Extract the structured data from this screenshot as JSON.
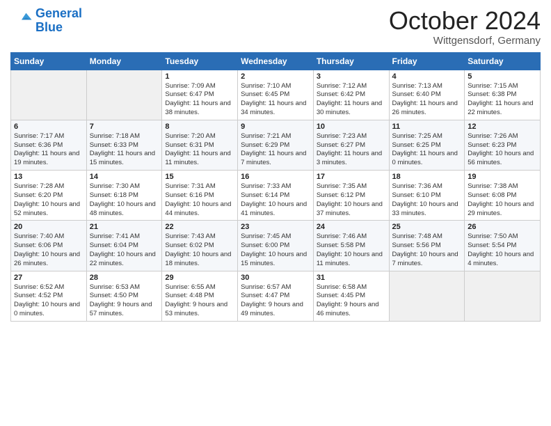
{
  "header": {
    "logo_line1": "General",
    "logo_line2": "Blue",
    "month": "October 2024",
    "location": "Wittgensdorf, Germany"
  },
  "days_of_week": [
    "Sunday",
    "Monday",
    "Tuesday",
    "Wednesday",
    "Thursday",
    "Friday",
    "Saturday"
  ],
  "weeks": [
    [
      {
        "day": "",
        "info": ""
      },
      {
        "day": "",
        "info": ""
      },
      {
        "day": "1",
        "info": "Sunrise: 7:09 AM\nSunset: 6:47 PM\nDaylight: 11 hours and 38 minutes."
      },
      {
        "day": "2",
        "info": "Sunrise: 7:10 AM\nSunset: 6:45 PM\nDaylight: 11 hours and 34 minutes."
      },
      {
        "day": "3",
        "info": "Sunrise: 7:12 AM\nSunset: 6:42 PM\nDaylight: 11 hours and 30 minutes."
      },
      {
        "day": "4",
        "info": "Sunrise: 7:13 AM\nSunset: 6:40 PM\nDaylight: 11 hours and 26 minutes."
      },
      {
        "day": "5",
        "info": "Sunrise: 7:15 AM\nSunset: 6:38 PM\nDaylight: 11 hours and 22 minutes."
      }
    ],
    [
      {
        "day": "6",
        "info": "Sunrise: 7:17 AM\nSunset: 6:36 PM\nDaylight: 11 hours and 19 minutes."
      },
      {
        "day": "7",
        "info": "Sunrise: 7:18 AM\nSunset: 6:33 PM\nDaylight: 11 hours and 15 minutes."
      },
      {
        "day": "8",
        "info": "Sunrise: 7:20 AM\nSunset: 6:31 PM\nDaylight: 11 hours and 11 minutes."
      },
      {
        "day": "9",
        "info": "Sunrise: 7:21 AM\nSunset: 6:29 PM\nDaylight: 11 hours and 7 minutes."
      },
      {
        "day": "10",
        "info": "Sunrise: 7:23 AM\nSunset: 6:27 PM\nDaylight: 11 hours and 3 minutes."
      },
      {
        "day": "11",
        "info": "Sunrise: 7:25 AM\nSunset: 6:25 PM\nDaylight: 11 hours and 0 minutes."
      },
      {
        "day": "12",
        "info": "Sunrise: 7:26 AM\nSunset: 6:23 PM\nDaylight: 10 hours and 56 minutes."
      }
    ],
    [
      {
        "day": "13",
        "info": "Sunrise: 7:28 AM\nSunset: 6:20 PM\nDaylight: 10 hours and 52 minutes."
      },
      {
        "day": "14",
        "info": "Sunrise: 7:30 AM\nSunset: 6:18 PM\nDaylight: 10 hours and 48 minutes."
      },
      {
        "day": "15",
        "info": "Sunrise: 7:31 AM\nSunset: 6:16 PM\nDaylight: 10 hours and 44 minutes."
      },
      {
        "day": "16",
        "info": "Sunrise: 7:33 AM\nSunset: 6:14 PM\nDaylight: 10 hours and 41 minutes."
      },
      {
        "day": "17",
        "info": "Sunrise: 7:35 AM\nSunset: 6:12 PM\nDaylight: 10 hours and 37 minutes."
      },
      {
        "day": "18",
        "info": "Sunrise: 7:36 AM\nSunset: 6:10 PM\nDaylight: 10 hours and 33 minutes."
      },
      {
        "day": "19",
        "info": "Sunrise: 7:38 AM\nSunset: 6:08 PM\nDaylight: 10 hours and 29 minutes."
      }
    ],
    [
      {
        "day": "20",
        "info": "Sunrise: 7:40 AM\nSunset: 6:06 PM\nDaylight: 10 hours and 26 minutes."
      },
      {
        "day": "21",
        "info": "Sunrise: 7:41 AM\nSunset: 6:04 PM\nDaylight: 10 hours and 22 minutes."
      },
      {
        "day": "22",
        "info": "Sunrise: 7:43 AM\nSunset: 6:02 PM\nDaylight: 10 hours and 18 minutes."
      },
      {
        "day": "23",
        "info": "Sunrise: 7:45 AM\nSunset: 6:00 PM\nDaylight: 10 hours and 15 minutes."
      },
      {
        "day": "24",
        "info": "Sunrise: 7:46 AM\nSunset: 5:58 PM\nDaylight: 10 hours and 11 minutes."
      },
      {
        "day": "25",
        "info": "Sunrise: 7:48 AM\nSunset: 5:56 PM\nDaylight: 10 hours and 7 minutes."
      },
      {
        "day": "26",
        "info": "Sunrise: 7:50 AM\nSunset: 5:54 PM\nDaylight: 10 hours and 4 minutes."
      }
    ],
    [
      {
        "day": "27",
        "info": "Sunrise: 6:52 AM\nSunset: 4:52 PM\nDaylight: 10 hours and 0 minutes."
      },
      {
        "day": "28",
        "info": "Sunrise: 6:53 AM\nSunset: 4:50 PM\nDaylight: 9 hours and 57 minutes."
      },
      {
        "day": "29",
        "info": "Sunrise: 6:55 AM\nSunset: 4:48 PM\nDaylight: 9 hours and 53 minutes."
      },
      {
        "day": "30",
        "info": "Sunrise: 6:57 AM\nSunset: 4:47 PM\nDaylight: 9 hours and 49 minutes."
      },
      {
        "day": "31",
        "info": "Sunrise: 6:58 AM\nSunset: 4:45 PM\nDaylight: 9 hours and 46 minutes."
      },
      {
        "day": "",
        "info": ""
      },
      {
        "day": "",
        "info": ""
      }
    ]
  ]
}
